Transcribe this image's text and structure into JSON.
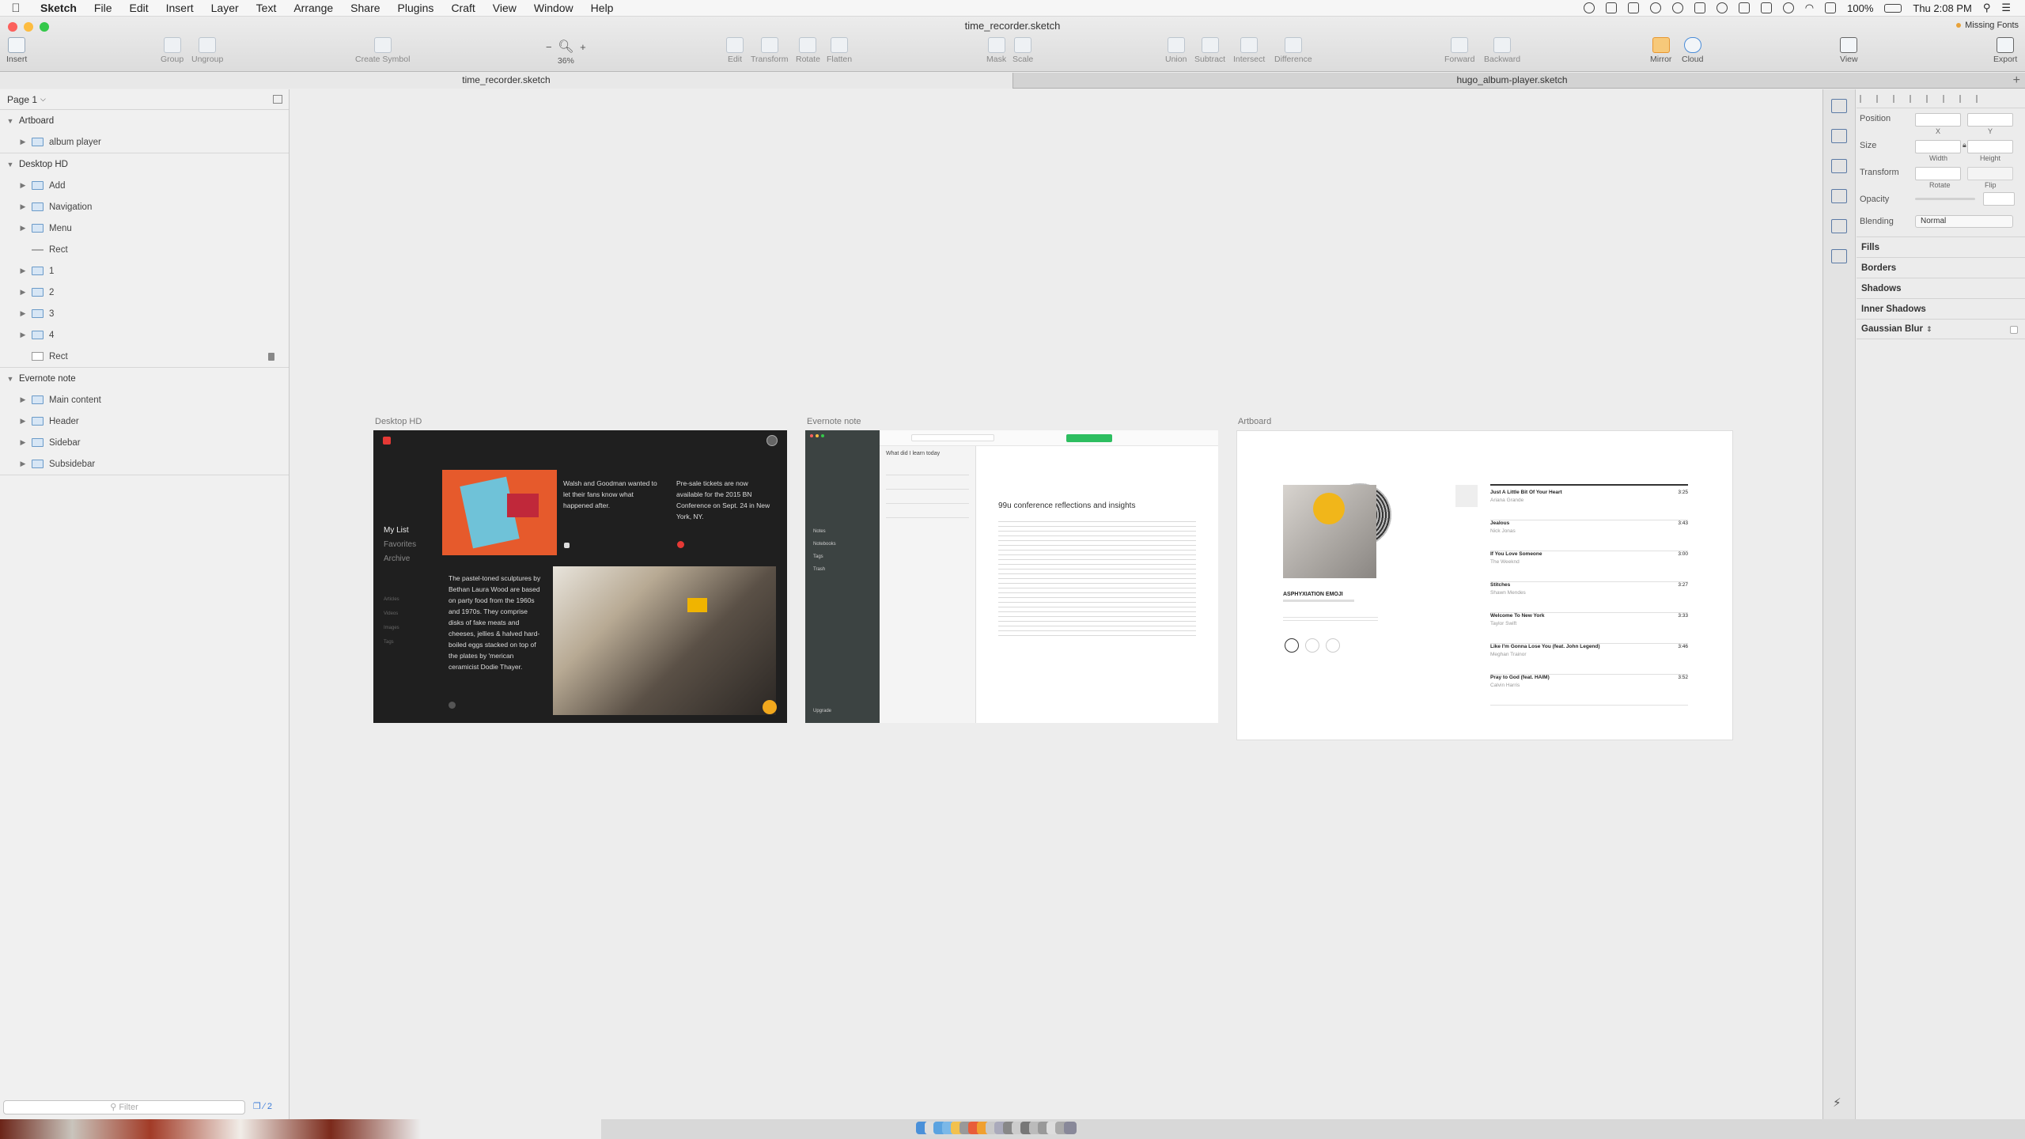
{
  "menubar": {
    "items": [
      "Sketch",
      "File",
      "Edit",
      "Insert",
      "Layer",
      "Text",
      "Arrange",
      "Share",
      "Plugins",
      "Craft",
      "View",
      "Window",
      "Help"
    ],
    "battery": "100%",
    "clock": "Thu 2:08 PM"
  },
  "window": {
    "title": "time_recorder.sketch",
    "missing_fonts": "Missing Fonts"
  },
  "toolbar": {
    "insert": "Insert",
    "group": "Group",
    "ungroup": "Ungroup",
    "create_symbol": "Create Symbol",
    "zoom_minus": "−",
    "zoom_plus": "+",
    "zoom_level": "36%",
    "edit": "Edit",
    "transform": "Transform",
    "rotate": "Rotate",
    "flatten": "Flatten",
    "mask": "Mask",
    "scale": "Scale",
    "union": "Union",
    "subtract": "Subtract",
    "intersect": "Intersect",
    "difference": "Difference",
    "forward": "Forward",
    "backward": "Backward",
    "mirror": "Mirror",
    "cloud": "Cloud",
    "view": "View",
    "export": "Export"
  },
  "tabs": {
    "tab1": "time_recorder.sketch",
    "tab2": "hugo_album-player.sketch",
    "add": "+"
  },
  "sidebar": {
    "page": "Page 1",
    "layers": [
      {
        "label": "Artboard",
        "kind": "artboard"
      },
      {
        "label": "album player",
        "kind": "folder"
      },
      {
        "label": "Desktop HD",
        "kind": "artboard"
      },
      {
        "label": "Add",
        "kind": "folder"
      },
      {
        "label": "Navigation",
        "kind": "folder"
      },
      {
        "label": "Menu",
        "kind": "folder"
      },
      {
        "label": "Rect",
        "kind": "line"
      },
      {
        "label": "1",
        "kind": "folder"
      },
      {
        "label": "2",
        "kind": "folder"
      },
      {
        "label": "3",
        "kind": "folder"
      },
      {
        "label": "4",
        "kind": "folder"
      },
      {
        "label": "Rect",
        "kind": "rect"
      },
      {
        "label": "Evernote note",
        "kind": "artboard"
      },
      {
        "label": "Main content",
        "kind": "folder"
      },
      {
        "label": "Header",
        "kind": "folder"
      },
      {
        "label": "Sidebar",
        "kind": "folder"
      },
      {
        "label": "Subsidebar",
        "kind": "folder"
      }
    ],
    "filter_placeholder": "Filter",
    "filter_count": "2"
  },
  "canvas": {
    "artboard1": {
      "label": "Desktop HD",
      "nav": [
        "My List",
        "Favorites",
        "Archive"
      ],
      "subnav": [
        "Articles",
        "Videos",
        "Images",
        "Tags"
      ],
      "card1": "Walsh and Goodman wanted to let their fans know what happened after.",
      "card2": "Pre-sale tickets are now available for the 2015 BN Conference on Sept. 24 in New York, NY.",
      "card3": "The pastel-toned sculptures by Bethan Laura Wood are based on party food from the 1960s and 1970s. They comprise disks of fake meats and cheeses, jellies & halved hard-boiled eggs stacked on top of the plates by 'merican ceramicist Dodie Thayer."
    },
    "artboard2": {
      "label": "Evernote note",
      "note_title": "99u conference reflections and insights",
      "list_header": "What did I learn today",
      "side_items": [
        "Notes",
        "Notebooks",
        "Tags",
        "Trash"
      ],
      "upgrade": "Upgrade"
    },
    "artboard3": {
      "label": "Artboard",
      "album": "ASPHYXIATION EMOJI",
      "tracks": [
        {
          "title": "Just A Little Bit Of Your Heart",
          "artist": "Ariana Grande",
          "time": "3:25"
        },
        {
          "title": "Jealous",
          "artist": "Nick Jonas",
          "time": "3:43"
        },
        {
          "title": "If You Love Someone",
          "artist": "The Weeknd",
          "time": "3:00"
        },
        {
          "title": "Stitches",
          "artist": "Shawn Mendes",
          "time": "3:27"
        },
        {
          "title": "Welcome To New York",
          "artist": "Taylor Swift",
          "time": "3:33"
        },
        {
          "title": "Like I'm Gonna Lose You (feat. John Legend)",
          "artist": "Meghan Trainor",
          "time": "3:46"
        },
        {
          "title": "Pray to God (feat. HAIM)",
          "artist": "Calvin Harris",
          "time": "3:52"
        }
      ]
    }
  },
  "inspector": {
    "position": "Position",
    "size": "Size",
    "transform": "Transform",
    "x": "X",
    "y": "Y",
    "width": "Width",
    "height": "Height",
    "rotate": "Rotate",
    "flip": "Flip",
    "opacity": "Opacity",
    "blending": "Blending",
    "blending_value": "Normal",
    "fills": "Fills",
    "borders": "Borders",
    "shadows": "Shadows",
    "inner_shadows": "Inner Shadows",
    "gaussian_blur": "Gaussian Blur"
  },
  "colors": {
    "close": "#fc605c",
    "minimize": "#fdbc40",
    "zoom": "#34c84a",
    "accent": "#3b7bd8",
    "evernote_green": "#2dbe60",
    "dark_bg": "#1f1f1f"
  }
}
